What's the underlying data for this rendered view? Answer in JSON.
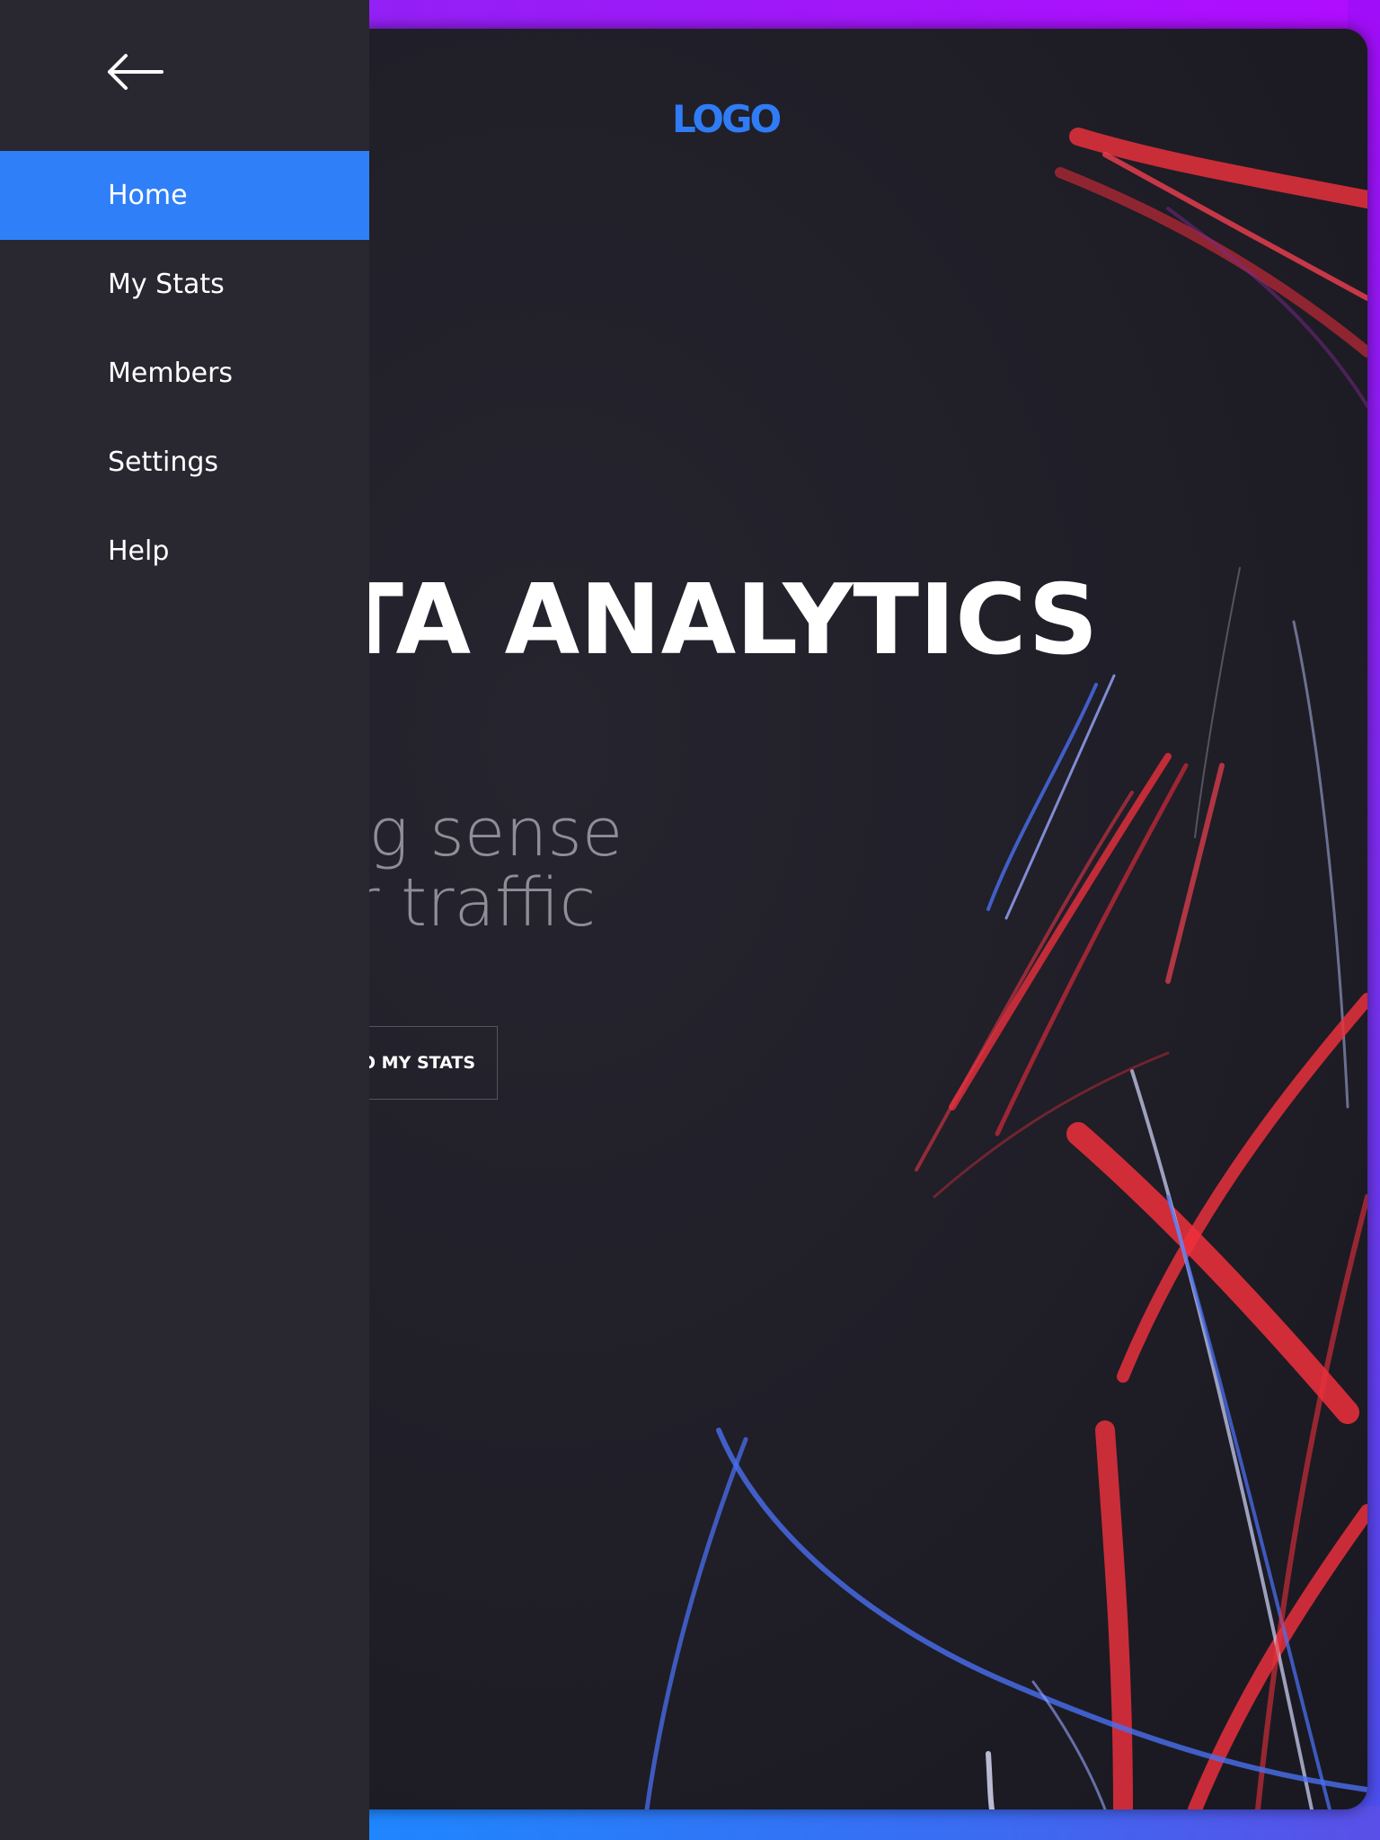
{
  "drawer": {
    "back_icon": "arrow-left-icon",
    "items": [
      {
        "label": "Home",
        "active": true
      },
      {
        "label": "My Stats",
        "active": false
      },
      {
        "label": "Members",
        "active": false
      },
      {
        "label": "Settings",
        "active": false
      },
      {
        "label": "Help",
        "active": false
      }
    ]
  },
  "hero": {
    "logo": "LOGO",
    "headline": "ATA ANALYTICS",
    "tagline_line1": "king sense",
    "tagline_line2": "our traffic",
    "cta_label": "O MY STATS"
  },
  "colors": {
    "accent": "#2f7ff8",
    "drawer_bg": "#292730",
    "hero_bg": "#24222c",
    "frame_purple": "#b10cff",
    "frame_blue": "#1f86ff",
    "trail_red": "#f0303c",
    "trail_blue": "#4a6ff0"
  }
}
